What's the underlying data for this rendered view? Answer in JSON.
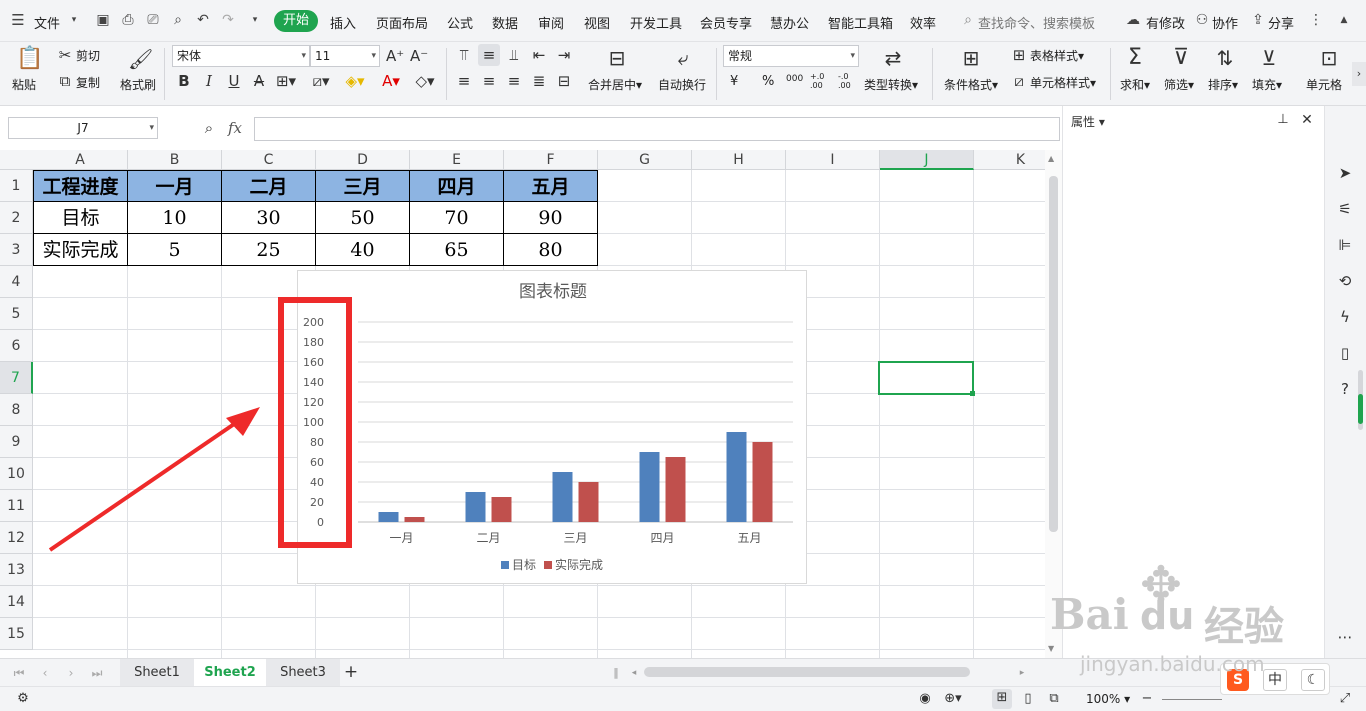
{
  "menubar": {
    "file": "文件",
    "tabs": [
      "开始",
      "插入",
      "页面布局",
      "公式",
      "数据",
      "审阅",
      "视图",
      "开发工具",
      "会员专享",
      "慧办公",
      "智能工具箱",
      "效率"
    ],
    "search_placeholder": "查找命令、搜索模板",
    "modify": "有修改",
    "collab": "协作",
    "share": "分享"
  },
  "ribbon": {
    "paste": "粘贴",
    "cut": "剪切",
    "copy": "复制",
    "format_painter": "格式刷",
    "font_name": "宋体",
    "font_size": "11",
    "merge_center": "合并居中",
    "wrap_text": "自动换行",
    "number_format": "常规",
    "type_convert": "类型转换",
    "cond_format": "条件格式",
    "table_style": "表格样式",
    "cell_style": "单元格样式",
    "sum": "求和",
    "filter": "筛选",
    "sort": "排序",
    "fill": "填充",
    "cell": "单元格",
    "currency": "¥",
    "percent": "%",
    "thousands": "000",
    "inc_decimal": "+.0 .00",
    "dec_decimal": "-.0 .00"
  },
  "formulabar": {
    "namebox": "J7",
    "fx": "fx",
    "value": ""
  },
  "sidepanel": {
    "title": "属性"
  },
  "columns": [
    "A",
    "B",
    "C",
    "D",
    "E",
    "F",
    "G",
    "H",
    "I",
    "J",
    "K"
  ],
  "rows": [
    "1",
    "2",
    "3",
    "4",
    "5",
    "6",
    "7",
    "8",
    "9",
    "10",
    "11",
    "12",
    "13",
    "14",
    "15"
  ],
  "table": {
    "header": [
      "工程进度",
      "一月",
      "二月",
      "三月",
      "四月",
      "五月"
    ],
    "row2": [
      "目标",
      "10",
      "30",
      "50",
      "70",
      "90"
    ],
    "row3": [
      "实际完成",
      "5",
      "25",
      "40",
      "65",
      "80"
    ]
  },
  "chart_data": {
    "type": "bar",
    "title": "图表标题",
    "categories": [
      "一月",
      "二月",
      "三月",
      "四月",
      "五月"
    ],
    "series": [
      {
        "name": "目标",
        "values": [
          10,
          30,
          50,
          70,
          90
        ],
        "color": "#4f81bd"
      },
      {
        "name": "实际完成",
        "values": [
          5,
          25,
          40,
          65,
          80
        ],
        "color": "#c0504d"
      }
    ],
    "ylim": [
      0,
      200
    ],
    "yticks": [
      0,
      20,
      40,
      60,
      80,
      100,
      120,
      140,
      160,
      180,
      200
    ],
    "grid": true,
    "legend": "bottom"
  },
  "annotation": {
    "highlight_color": "#ee2a2a"
  },
  "sheets": {
    "tabs": [
      "Sheet1",
      "Sheet2",
      "Sheet3"
    ],
    "active": "Sheet2",
    "add": "+"
  },
  "statusbar": {
    "zoom": "100%",
    "ime_lang": "中"
  },
  "watermark": {
    "brand": "Bai",
    "brand2": "du",
    "cn": "经验",
    "url": "jingyan.baidu.com"
  },
  "colors": {
    "accent": "#1fa44f",
    "header_fill": "#8db4e2"
  }
}
